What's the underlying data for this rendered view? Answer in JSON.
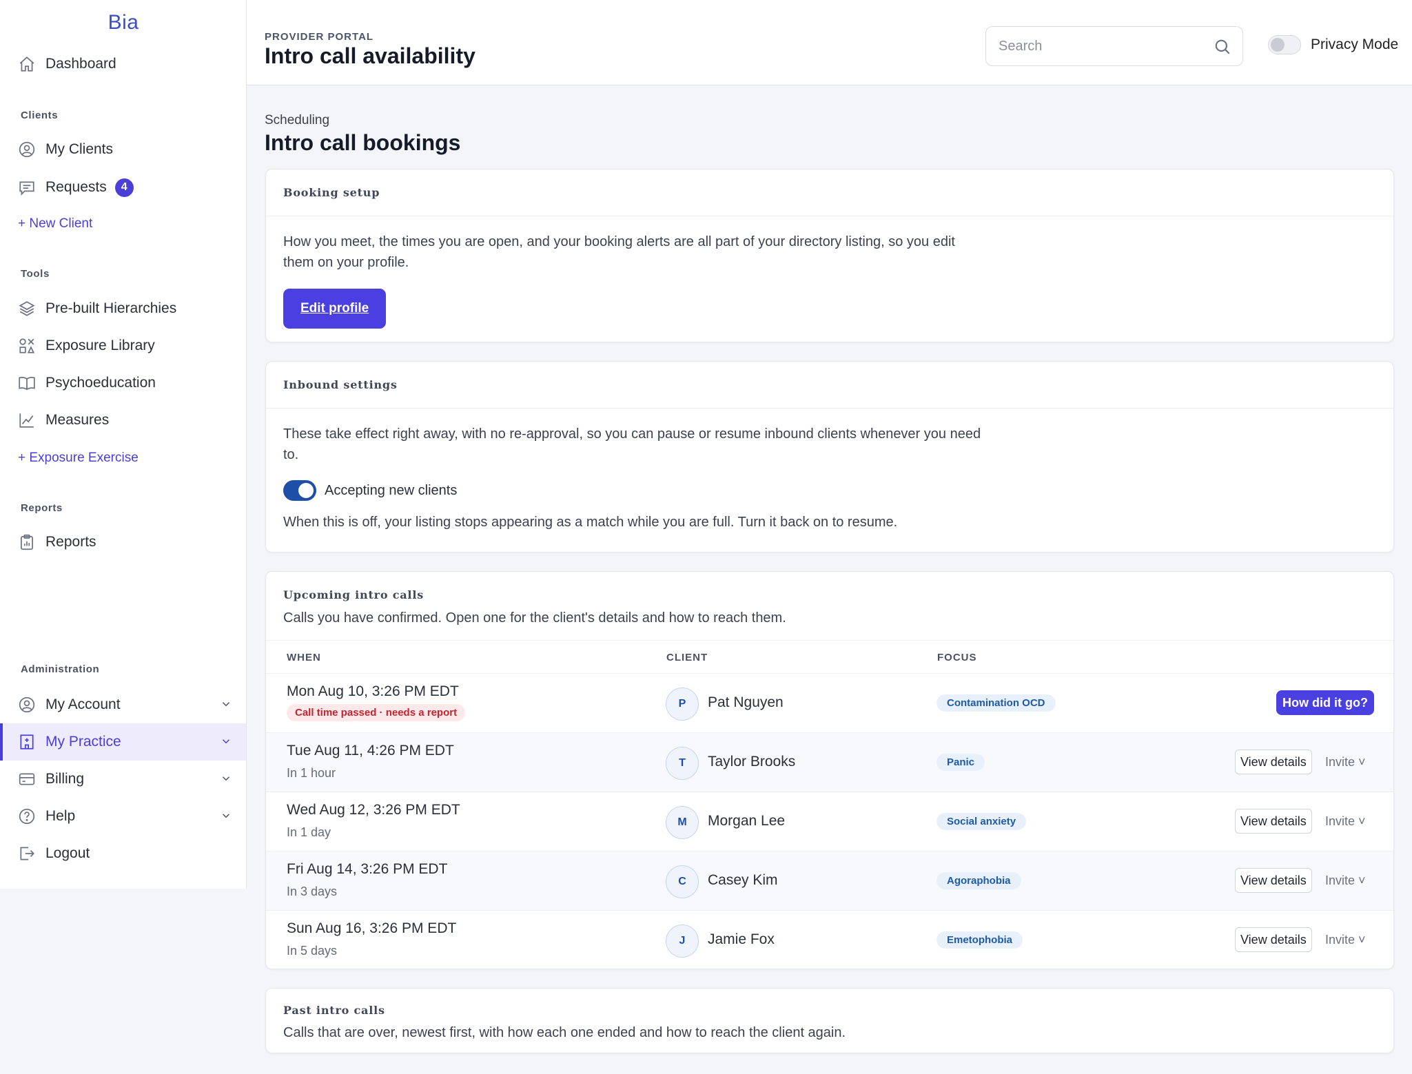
{
  "brand": "Bia",
  "sidebar": {
    "dashboard": "Dashboard",
    "clients_label": "Clients",
    "my_clients": "My Clients",
    "requests": "Requests",
    "requests_count": "4",
    "new_client": "+ New Client",
    "tools_label": "Tools",
    "prebuilt": "Pre-built Hierarchies",
    "exposure_library": "Exposure Library",
    "psychoeducation": "Psychoeducation",
    "measures": "Measures",
    "exposure_exercise": "+ Exposure Exercise",
    "reports_label": "Reports",
    "reports": "Reports",
    "admin_label": "Administration",
    "my_account": "My Account",
    "my_practice": "My Practice",
    "billing": "Billing",
    "help": "Help",
    "logout": "Logout"
  },
  "header": {
    "kicker": "PROVIDER PORTAL",
    "title": "Intro call availability",
    "search_placeholder": "Search",
    "privacy_label": "Privacy Mode"
  },
  "main": {
    "breadcrumb": "Scheduling",
    "heading": "Intro call bookings"
  },
  "booking_setup": {
    "title": "Booking setup",
    "text": "How you meet, the times you are open, and your booking alerts are all part of your directory listing, so you edit them on your profile.",
    "button": "Edit profile"
  },
  "inbound": {
    "title": "Inbound settings",
    "text": "These take effect right away, with no re-approval, so you can pause or resume inbound clients whenever you need to.",
    "toggle_label": "Accepting new clients",
    "toggle_on": true,
    "note": "When this is off, your listing stops appearing as a match while you are full. Turn it back on to resume."
  },
  "upcoming": {
    "title": "Upcoming intro calls",
    "subtitle": "Calls you have confirmed. Open one for the client's details and how to reach them.",
    "columns": [
      "WHEN",
      "CLIENT",
      "FOCUS"
    ],
    "view_label": "View details",
    "invite_label": "Invite ˅",
    "report_label": "How did it go?",
    "rows": [
      {
        "when": "Mon Aug 10, 3:26 PM EDT",
        "status": "Call time passed · needs a report",
        "initial": "P",
        "client": "Pat Nguyen",
        "focus": "Contamination OCD"
      },
      {
        "when": "Tue Aug 11, 4:26 PM EDT",
        "status": "In 1 hour",
        "initial": "T",
        "client": "Taylor Brooks",
        "focus": "Panic"
      },
      {
        "when": "Wed Aug 12, 3:26 PM EDT",
        "status": "In 1 day",
        "initial": "M",
        "client": "Morgan Lee",
        "focus": "Social anxiety"
      },
      {
        "when": "Fri Aug 14, 3:26 PM EDT",
        "status": "In 3 days",
        "initial": "C",
        "client": "Casey Kim",
        "focus": "Agoraphobia"
      },
      {
        "when": "Sun Aug 16, 3:26 PM EDT",
        "status": "In 5 days",
        "initial": "J",
        "client": "Jamie Fox",
        "focus": "Emetophobia"
      }
    ]
  },
  "past": {
    "title": "Past intro calls",
    "subtitle": "Calls that are over, newest first, with how each one ended and how to reach the client again."
  },
  "colors": {
    "accent": "#4a3fe0",
    "toggle": "#1e4fa8",
    "warning": "#c4242f",
    "tag_bg": "#e8f1fb"
  }
}
